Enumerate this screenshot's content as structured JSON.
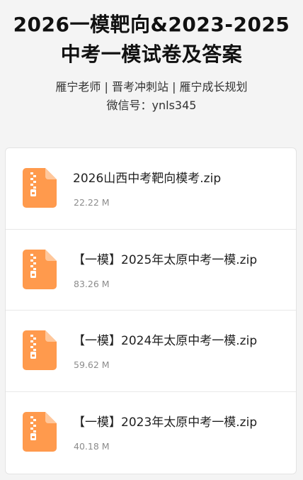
{
  "header": {
    "title_line1": "2026一模靶向&2023-2025",
    "title_line2": "中考一模试卷及答案",
    "subtitle_line1": "雁宁老师 | 晋考冲刺站 | 雁宁成长规划",
    "subtitle_line2": "微信号：ynls345"
  },
  "files": [
    {
      "name": "2026山西中考靶向模考.zip",
      "size": "22.22 M",
      "icon": "zip-file-icon"
    },
    {
      "name": "【一模】2025年太原中考一模.zip",
      "size": "83.26 M",
      "icon": "zip-file-icon"
    },
    {
      "name": "【一模】2024年太原中考一模.zip",
      "size": "59.62 M",
      "icon": "zip-file-icon"
    },
    {
      "name": "【一模】2023年太原中考一模.zip",
      "size": "40.18 M",
      "icon": "zip-file-icon"
    }
  ],
  "colors": {
    "icon_orange": "#ff9a4d",
    "icon_fold": "#ffc79b"
  }
}
